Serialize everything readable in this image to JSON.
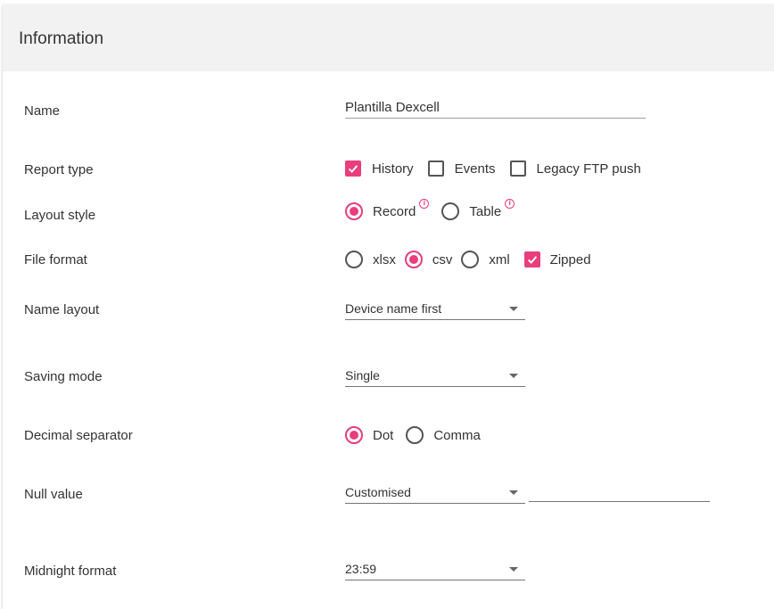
{
  "header": {
    "title": "Information"
  },
  "fields": {
    "name": {
      "label": "Name",
      "value": "Plantilla Dexcell"
    },
    "report_type": {
      "label": "Report type",
      "options": [
        {
          "label": "History",
          "checked": true
        },
        {
          "label": "Events",
          "checked": false
        },
        {
          "label": "Legacy FTP push",
          "checked": false
        }
      ]
    },
    "layout_style": {
      "label": "Layout style",
      "options": [
        {
          "label": "Record",
          "selected": true
        },
        {
          "label": "Table",
          "selected": false
        }
      ]
    },
    "file_format": {
      "label": "File format",
      "options": [
        {
          "label": "xlsx",
          "selected": false
        },
        {
          "label": "csv",
          "selected": true
        },
        {
          "label": "xml",
          "selected": false
        }
      ],
      "zipped": {
        "label": "Zipped",
        "checked": true
      }
    },
    "name_layout": {
      "label": "Name layout",
      "value": "Device name first"
    },
    "saving_mode": {
      "label": "Saving mode",
      "value": "Single"
    },
    "decimal_separator": {
      "label": "Decimal separator",
      "options": [
        {
          "label": "Dot",
          "selected": true
        },
        {
          "label": "Comma",
          "selected": false
        }
      ]
    },
    "null_value": {
      "label": "Null value",
      "value": "Customised",
      "custom_value": ""
    },
    "midnight_format": {
      "label": "Midnight format",
      "value": "23:59"
    }
  },
  "colors": {
    "accent": "#e83e7c",
    "header_bg": "#f2f2f2"
  },
  "icons": {
    "info": "info-icon",
    "check": "check-icon",
    "dropdown": "chevron-down-icon"
  }
}
